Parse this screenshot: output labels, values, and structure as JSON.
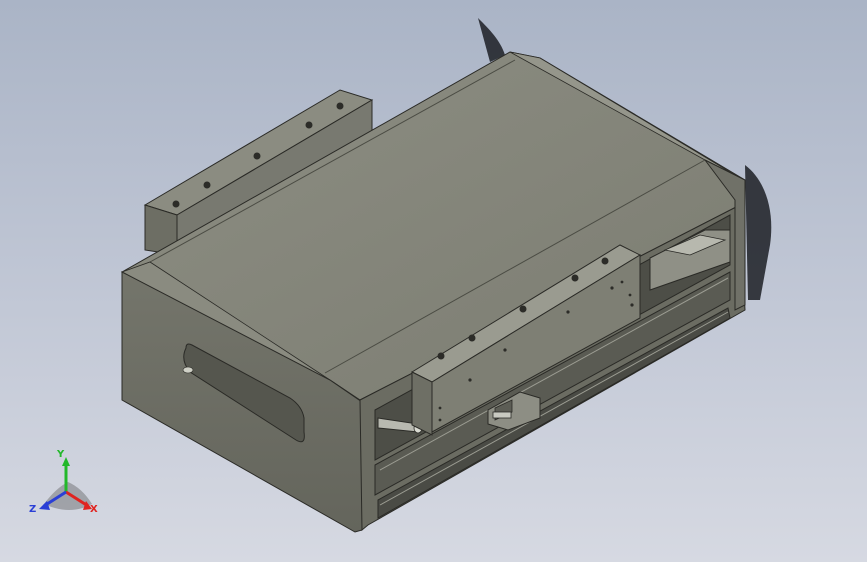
{
  "viewport": {
    "background_top": "#aab4c6",
    "background_bottom": "#d6d9e2"
  },
  "model": {
    "body_color": "#7e7f74",
    "top_color": "#85867b",
    "edge_color": "#2a2a26",
    "front_color": "#6f7066"
  },
  "triad": {
    "x_label": "X",
    "y_label": "Y",
    "z_label": "Z",
    "x_color": "#e0231f",
    "y_color": "#22b82a",
    "z_color": "#2a3fd6"
  }
}
